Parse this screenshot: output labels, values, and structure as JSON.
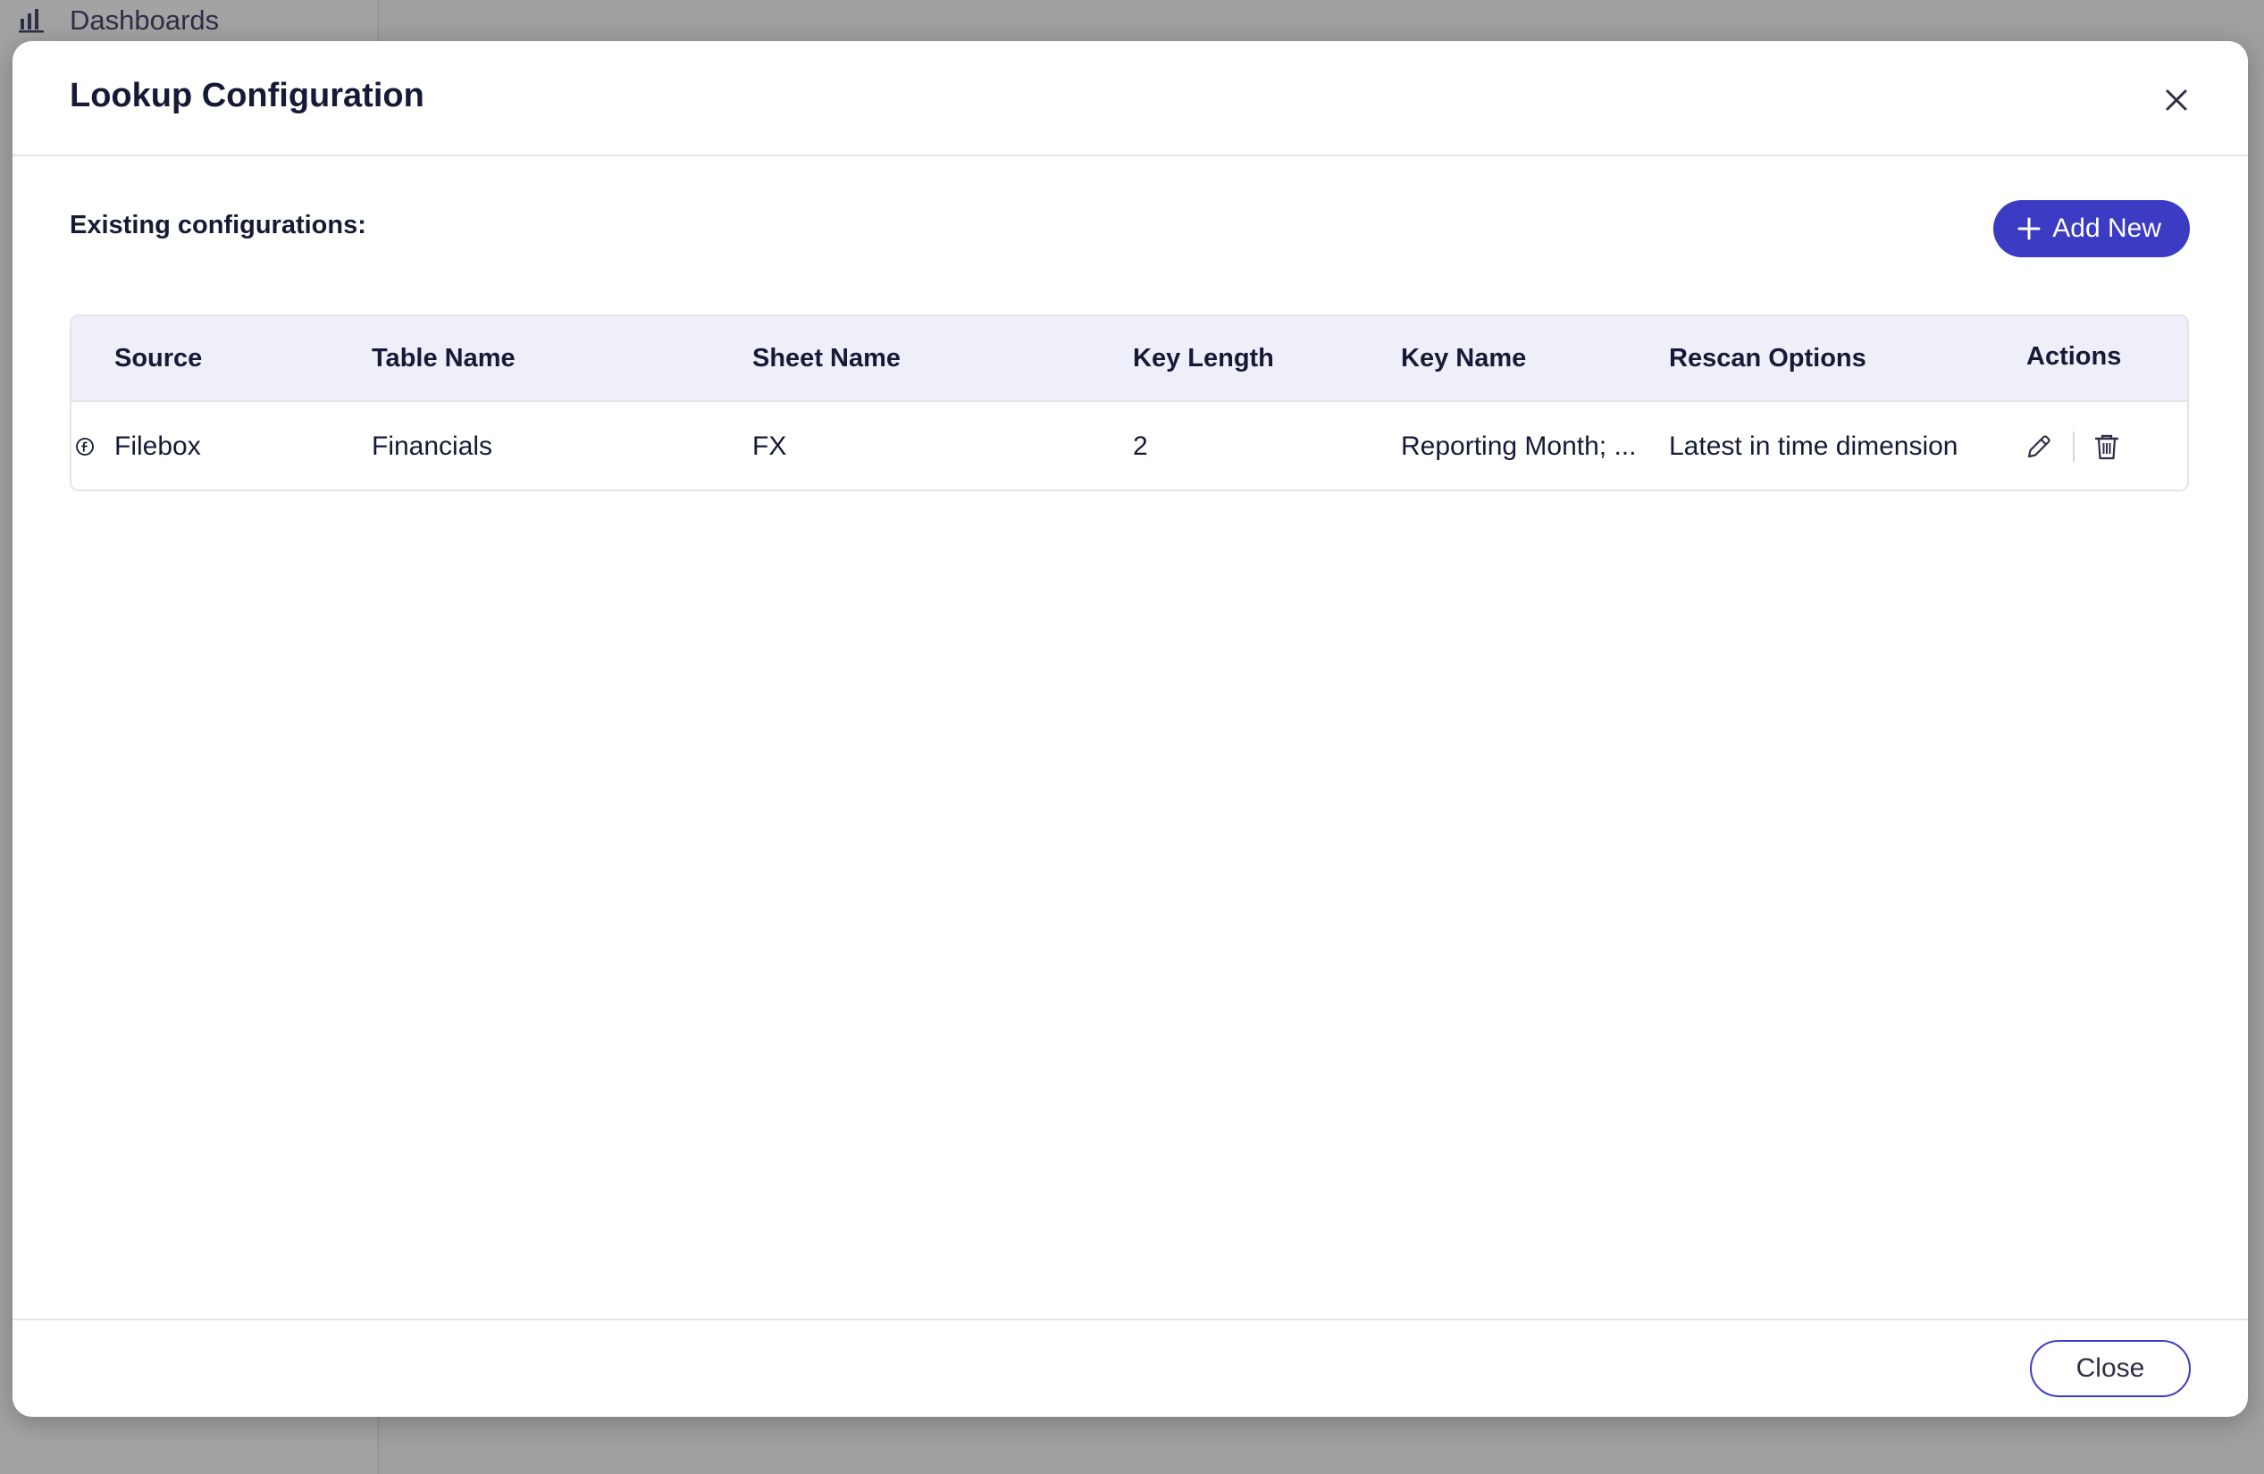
{
  "background": {
    "nav_item_label": "Dashboards",
    "nav_item_icon": "bar-chart-icon"
  },
  "modal": {
    "title": "Lookup Configuration",
    "close_icon": "close-icon",
    "section_label": "Existing configurations:",
    "add_new_label": "Add New",
    "add_new_icon": "plus-icon",
    "footer_close_label": "Close",
    "accent_color": "#3b3bc4"
  },
  "table": {
    "columns": [
      "Source",
      "Table Name",
      "Sheet Name",
      "Key Length",
      "Key Name",
      "Rescan Options",
      "Actions"
    ],
    "rows": [
      {
        "source_icon": "filebox-icon",
        "source": "Filebox",
        "table_name": "Financials",
        "sheet_name": "FX",
        "key_length": "2",
        "key_name": "Reporting Month; ...",
        "rescan_options": "Latest in time dimension",
        "actions": [
          "edit-icon",
          "trash-icon"
        ]
      }
    ]
  }
}
